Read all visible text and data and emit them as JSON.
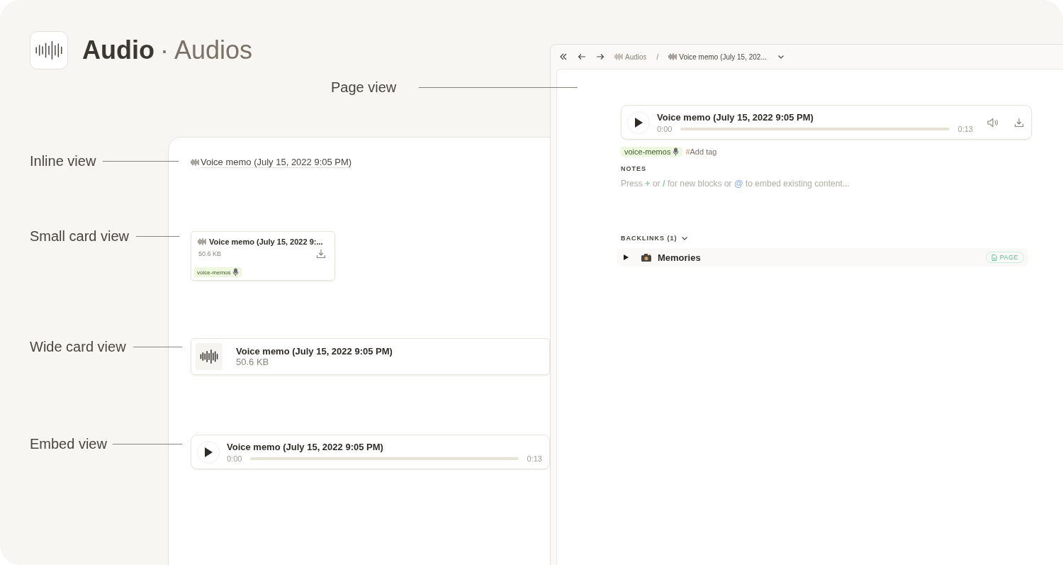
{
  "header": {
    "title": "Audio",
    "separator": "·",
    "subtitle": "Audios"
  },
  "callouts": [
    {
      "label": "Page view"
    },
    {
      "label": "Inline view"
    },
    {
      "label": "Small card view"
    },
    {
      "label": "Wide card view"
    },
    {
      "label": "Embed view"
    }
  ],
  "inline_view": {
    "title": "Voice memo (July 15, 2022 9:05 PM)"
  },
  "small_card": {
    "title": "Voice memo (July 15, 2022 9:...",
    "size": "50.6 KB",
    "tag": "voice-memos"
  },
  "wide_card": {
    "title": "Voice memo (July 15, 2022 9:05 PM)",
    "size": "50.6 KB"
  },
  "embed": {
    "title": "Voice memo (July 15, 2022 9:05 PM)",
    "start": "0:00",
    "end": "0:13",
    "level": 0
  },
  "page_view": {
    "breadcrumbs": [
      {
        "label": "Audios"
      },
      {
        "label": "Voice memo (July 15, 202..."
      }
    ],
    "breadcrumb_separator": "/",
    "player": {
      "title": "Voice memo (July 15, 2022 9:05 PM)",
      "start": "0:00",
      "end": "0:13",
      "level": 0
    },
    "tags": [
      {
        "label": "voice-memos"
      }
    ],
    "add_tag": {
      "hash": "#",
      "label": "Add tag"
    },
    "notes": {
      "heading": "NOTES",
      "placeholder": [
        {
          "kind": "text",
          "text": "Press "
        },
        {
          "kind": "key",
          "text": "+",
          "color": "#8fd19e"
        },
        {
          "kind": "text",
          "text": " or "
        },
        {
          "kind": "key",
          "text": "/",
          "color": "#8fd19e"
        },
        {
          "kind": "text",
          "text": " for new blocks or "
        },
        {
          "kind": "key",
          "text": "@",
          "color": "#8eb0f0"
        },
        {
          "kind": "text",
          "text": " to embed existing content..."
        }
      ]
    },
    "backlinks": {
      "heading": "BACKLINKS (1)",
      "expanded": true,
      "items": [
        {
          "title": "Memories",
          "badge": "PAGE",
          "expanded": false
        }
      ]
    }
  }
}
